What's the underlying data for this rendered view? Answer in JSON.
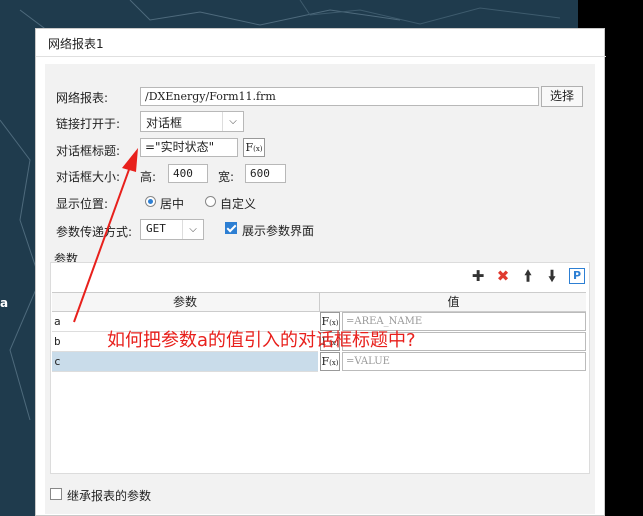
{
  "background": {
    "side_letter": "a"
  },
  "dialog": {
    "title": "网络报表1",
    "report": {
      "label": "网络报表:",
      "value": "/DXEnergy/Form11.frm",
      "choose_button": "选择"
    },
    "open_in": {
      "label": "链接打开于:",
      "selected": "对话框"
    },
    "dialog_title": {
      "label": "对话框标题:",
      "value": "=\"实时状态\""
    },
    "dialog_size": {
      "label": "对话框大小:",
      "height_label": "高:",
      "height_value": "400",
      "width_label": "宽:",
      "width_value": "600"
    },
    "position": {
      "label": "显示位置:",
      "option_center": "居中",
      "option_custom": "自定义",
      "selected": "居中"
    },
    "param_method": {
      "label": "参数传递方式:",
      "selected": "GET",
      "show_params_label": "展示参数界面",
      "show_params_checked": true
    },
    "params": {
      "section_label": "参数",
      "col_name": "参数",
      "col_value": "值",
      "fx_label": "F",
      "fx_sub": "(x)",
      "rows": [
        {
          "name": "a",
          "value": "=AREA_NAME"
        },
        {
          "name": "b",
          "value": ""
        },
        {
          "name": "c",
          "value": "=VALUE"
        }
      ]
    },
    "inherit_params": {
      "label": "继承报表的参数",
      "checked": false
    }
  },
  "annotation": {
    "text": "如何把参数a的值引入的对话框标题中?",
    "color": "#e8201c"
  },
  "colors": {
    "accent": "#2d7fd3",
    "delete_icon": "#e03a2f",
    "selected_row": "#c9dcea"
  }
}
